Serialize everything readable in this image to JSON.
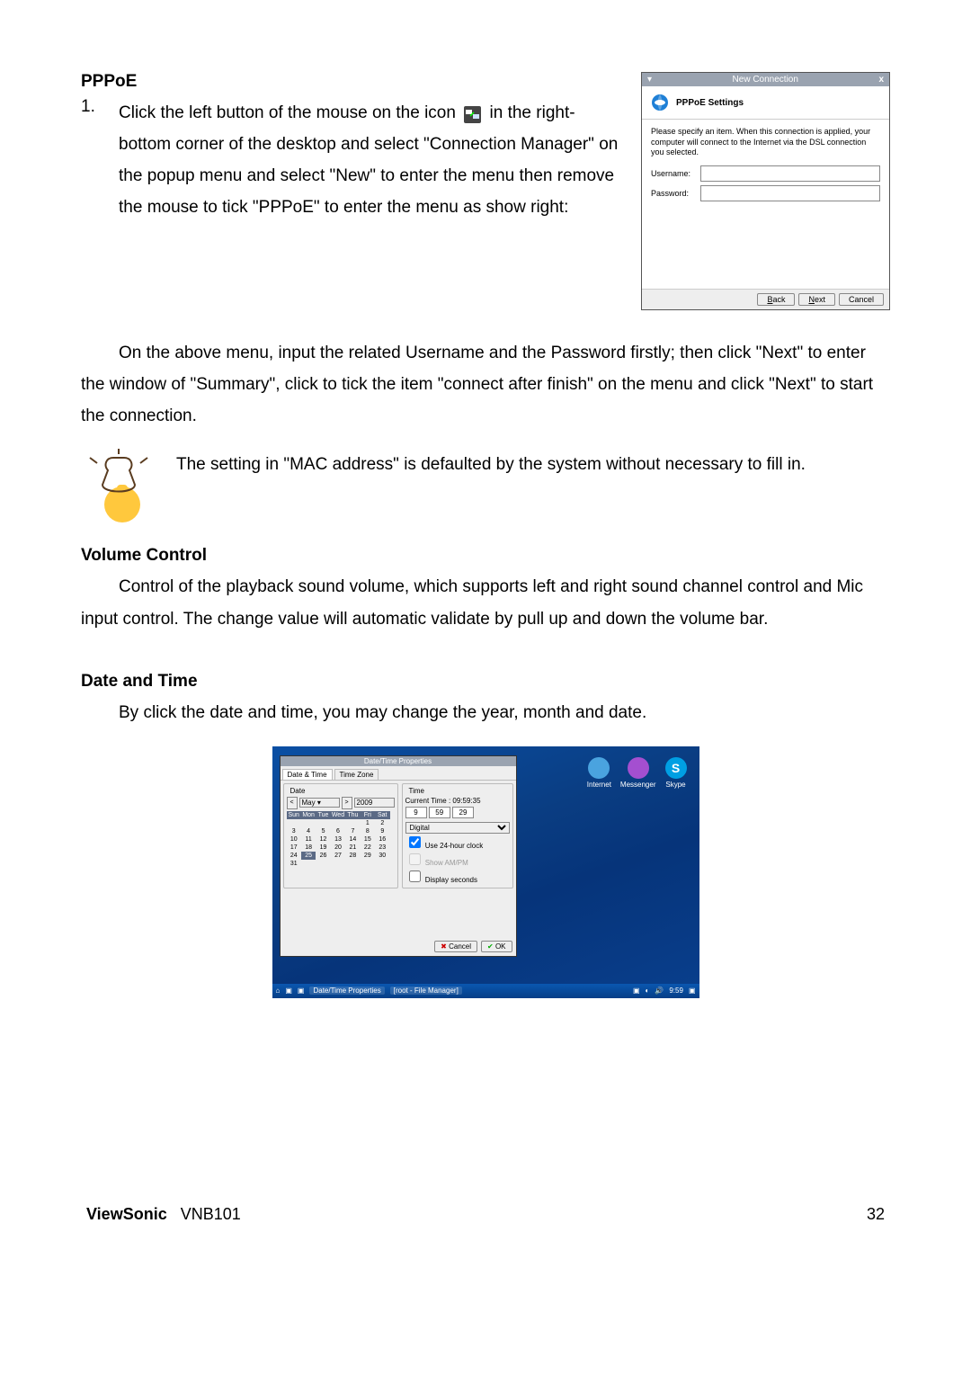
{
  "s1": {
    "heading": "PPPoE",
    "num": "1.",
    "line1_a": "Click the left button of the mouse on the icon ",
    "line1_b": " in the right-bottom corner of the desktop and select \"Connection Manager\" on the popup menu and select \"New\" to enter the menu then remove the mouse to tick \"PPPoE\" to enter the menu as show right:"
  },
  "pppoe": {
    "title": "New Connection",
    "close": "x",
    "hdr": "PPPoE Settings",
    "desc": "Please specify an item. When this connection is applied, your computer will connect to the Internet via the DSL connection you selected.",
    "username_label": "Username:",
    "password_label": "Password:",
    "back": "Back",
    "next": "Next",
    "cancel": "Cancel"
  },
  "para2": "On the above menu, input the related Username and the Password firstly; then click \"Next\" to enter the window of \"Summary\", click to tick the item \"connect after finish\" on the menu and click \"Next\" to start the connection.",
  "note": "The setting in \"MAC address\" is defaulted by the system without necessary to fill in.",
  "s2": {
    "heading": "Volume Control",
    "body": "Control of the playback sound volume, which supports left and right sound channel control and Mic input control. The change value will automatic validate by pull up and down the volume bar."
  },
  "s3": {
    "heading": "Date and Time",
    "body": "By click the date and time, you may change the year, month and date."
  },
  "dt": {
    "title": "Date/Time Properties",
    "tabs": [
      "Date & Time",
      "Time Zone"
    ],
    "date_label": "Date",
    "month": "May",
    "year": "2009",
    "weekdays": [
      "Sun",
      "Mon",
      "Tue",
      "Wed",
      "Thu",
      "Fri",
      "Sat"
    ],
    "rows": [
      [
        "",
        "",
        "",
        "",
        "",
        "1",
        "2"
      ],
      [
        "3",
        "4",
        "5",
        "6",
        "7",
        "8",
        "9"
      ],
      [
        "10",
        "11",
        "12",
        "13",
        "14",
        "15",
        "16"
      ],
      [
        "17",
        "18",
        "19",
        "20",
        "21",
        "22",
        "23"
      ],
      [
        "24",
        "25",
        "26",
        "27",
        "28",
        "29",
        "30"
      ],
      [
        "31",
        "",
        "",
        "",
        "",
        "",
        ""
      ]
    ],
    "selected": "25",
    "time_label": "Time",
    "current_time_label": "Current Time :",
    "current_time_value": "09:59:35",
    "h": "9",
    "m": "59",
    "s": "29",
    "digital": "Digital",
    "opt24": "Use 24-hour clock",
    "optampm": "Show AM/PM",
    "optsec": "Display seconds",
    "cancel": "Cancel",
    "ok": "OK",
    "desk": [
      {
        "label": "Internet",
        "color": "#4aa3df"
      },
      {
        "label": "Messenger",
        "color": "#a44fd0"
      },
      {
        "label": "Skype",
        "color": "#009fe3",
        "letter": "S"
      }
    ],
    "task1": "Date/Time Properties",
    "task2": "[root - File Manager]",
    "clock": "9:59"
  },
  "footer": {
    "brand": "ViewSonic",
    "model": "VNB101",
    "page": "32"
  }
}
